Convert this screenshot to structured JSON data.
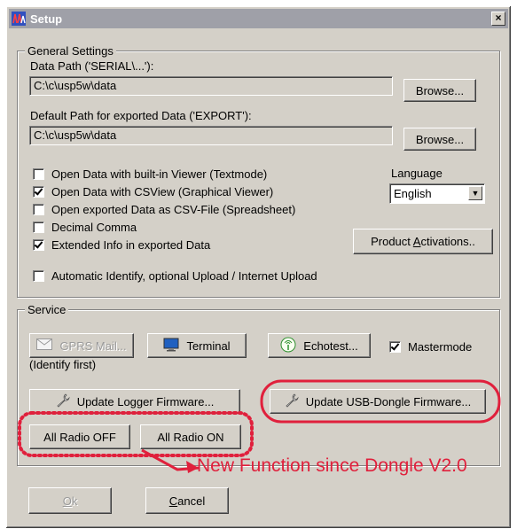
{
  "window": {
    "title": "Setup",
    "close_glyph": "×"
  },
  "general": {
    "legend": "General Settings",
    "data_path_label": "Data Path ('SERIAL\\...'):",
    "data_path_value": "C:\\c\\usp5w\\data",
    "export_path_label": "Default Path for exported Data ('EXPORT'):",
    "export_path_value": "C:\\c\\usp5w\\data",
    "browse_label": "Browse...",
    "options": [
      {
        "label": "Open Data with built-in Viewer (Textmode)",
        "checked": false
      },
      {
        "label": "Open Data with CSView (Graphical Viewer)",
        "checked": true
      },
      {
        "label": "Open exported Data as CSV-File (Spreadsheet)",
        "checked": false
      },
      {
        "label": "Decimal Comma",
        "checked": false
      },
      {
        "label": "Extended Info in exported Data",
        "checked": true
      }
    ],
    "auto_identify": {
      "label": "Automatic Identify, optional Upload / Internet Upload",
      "checked": false
    },
    "language_label": "Language",
    "language_value": "English",
    "activations_pre": "Product ",
    "activations_ul": "A",
    "activations_post": "ctivations.."
  },
  "service": {
    "legend": "Service",
    "gprs_label": "GPRS Mail...",
    "identify_note": "(Identify first)",
    "terminal_label": "Terminal",
    "echotest_label": "Echotest...",
    "mastermode": {
      "label": "Mastermode",
      "checked": true
    },
    "update_logger_label": "Update Logger Firmware...",
    "update_dongle_label": "Update USB-Dongle Firmware...",
    "radio_off_label": "All Radio OFF",
    "radio_on_label": "All Radio ON"
  },
  "annotation": {
    "text": "New Function since Dongle V2.0",
    "color": "#e0203c"
  },
  "footer": {
    "ok_ul": "O",
    "ok_rest": "k",
    "cancel_ul": "C",
    "cancel_rest": "ancel"
  },
  "icons": [
    "app-icon",
    "mail-icon",
    "monitor-icon",
    "antenna-icon",
    "wrench-icon"
  ]
}
